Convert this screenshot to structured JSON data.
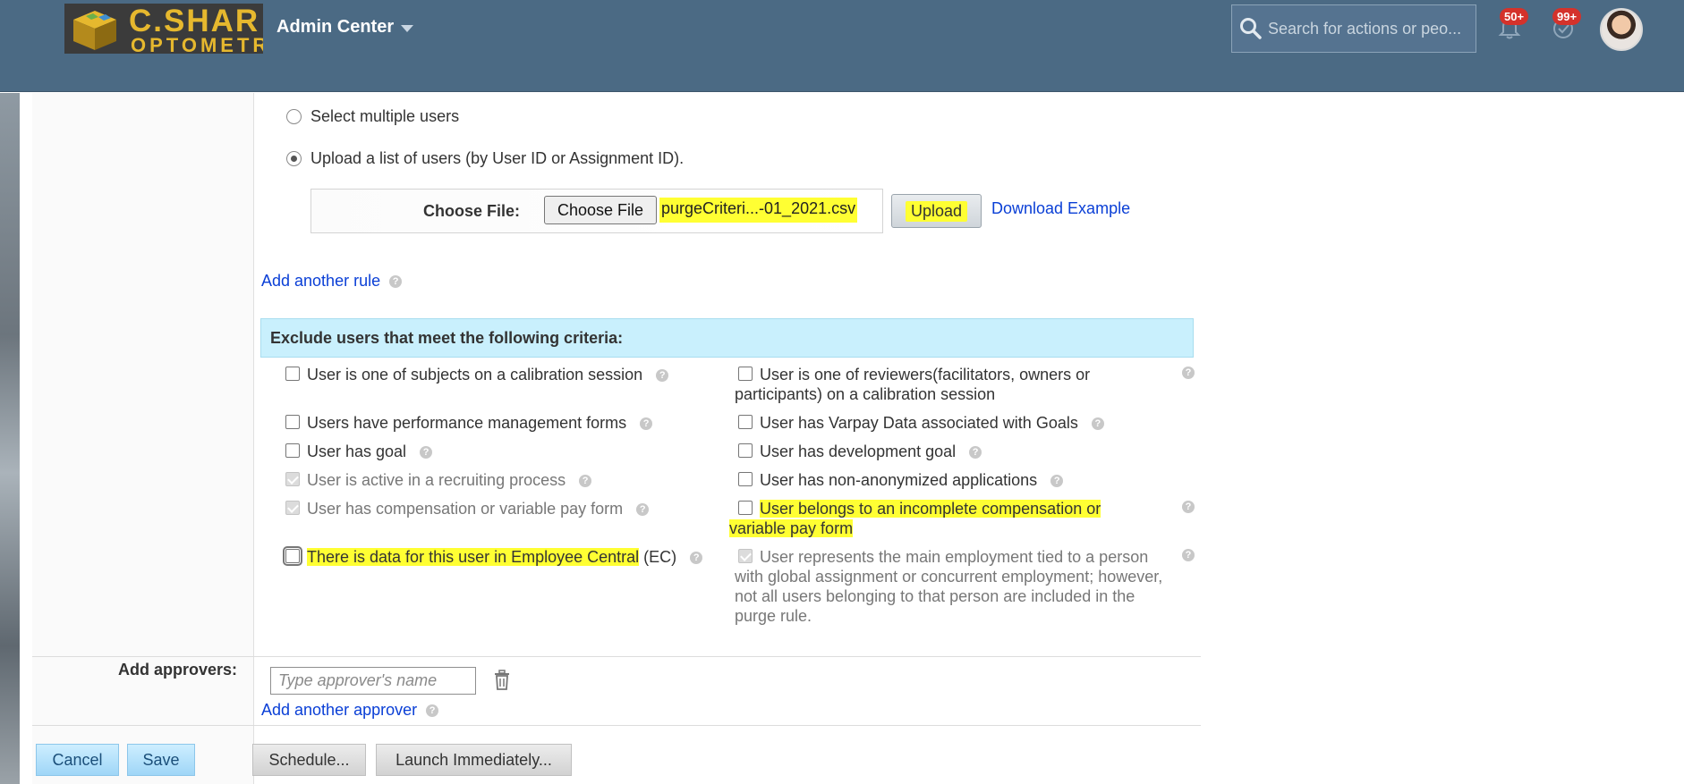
{
  "header": {
    "logo_line1": "C.SHAR",
    "logo_line2": "OPTOMETR",
    "app_title": "Admin Center",
    "search_placeholder": "Search for actions or peo...",
    "notifications_badge": "50+",
    "todo_badge": "99+",
    "colors": {
      "bar": "#4b6a84",
      "logo_text": "#e6b82e",
      "badge": "#d4322b"
    }
  },
  "user_selection": {
    "option_multiple": "Select multiple users",
    "option_upload": "Upload a list of users (by User ID or Assignment ID).",
    "selected": "option_upload",
    "file_label": "Choose File:",
    "choose_button": "Choose File",
    "file_name": "purgeCriteri...-01_2021.csv",
    "upload_button": "Upload",
    "download_link": "Download Example"
  },
  "add_rule_link": "Add another rule",
  "criteria": {
    "heading": "Exclude users that meet the following criteria:",
    "left": [
      {
        "label": "User is one of subjects on a calibration session",
        "checked": false,
        "disabled": false
      },
      {
        "label": "Users have performance management forms",
        "checked": false,
        "disabled": false
      },
      {
        "label": "User has goal",
        "checked": false,
        "disabled": false
      },
      {
        "label": "User is active in a recruiting process",
        "checked": true,
        "disabled": true
      },
      {
        "label": "User has compensation or variable pay form",
        "checked": true,
        "disabled": true
      },
      {
        "label_highlight": "There is data for this user in Employee Central",
        "label_rest": " (EC)",
        "checked": false,
        "disabled": false
      }
    ],
    "right": [
      {
        "label": "User is one of reviewers(facilitators, owners or participants) on a calibration session",
        "checked": false,
        "disabled": false
      },
      {
        "label": "User has Varpay Data associated with Goals",
        "checked": false,
        "disabled": false
      },
      {
        "label": "User has development goal",
        "checked": false,
        "disabled": false
      },
      {
        "label": "User has non-anonymized applications",
        "checked": false,
        "disabled": false
      },
      {
        "label": "User belongs to an incomplete compensation or variable pay form",
        "checked": false,
        "disabled": false
      },
      {
        "label": "User represents the main employment tied to a person with global assignment or concurrent employment; however, not all users belonging to that person are included in the purge rule.",
        "checked": true,
        "disabled": true
      }
    ],
    "highlight_color": "#ffff33"
  },
  "approvers": {
    "label": "Add approvers:",
    "input_placeholder": "Type approver's name",
    "add_link": "Add another approver"
  },
  "actions": {
    "cancel": "Cancel",
    "save": "Save",
    "schedule": "Schedule...",
    "launch": "Launch Immediately..."
  }
}
